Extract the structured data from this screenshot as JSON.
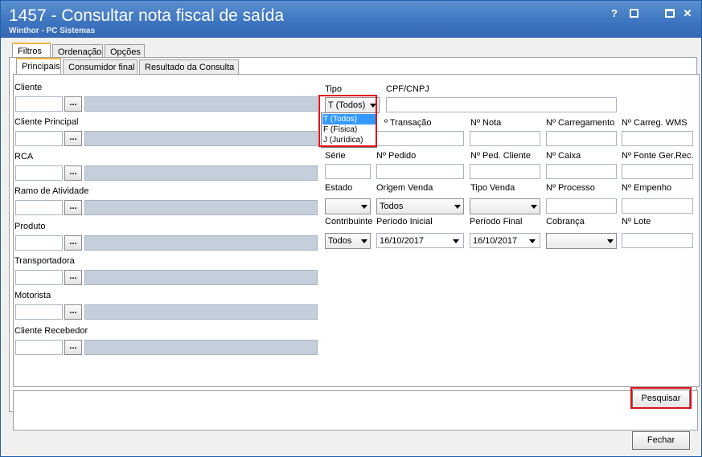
{
  "window": {
    "title": "1457 - Consultar nota fiscal de saída",
    "subtitle": "Winthor - PC Sistemas",
    "help_label": "?"
  },
  "top_tabs": [
    "Filtros",
    "Ordenação",
    "Opções"
  ],
  "sub_tabs": [
    "Principais",
    "Consumidor final",
    "Resultado da Consulta"
  ],
  "left_fields": [
    "Cliente",
    "Cliente Principal",
    "RCA",
    "Ramo de Atividade",
    "Produto",
    "Transportadora",
    "Motorista",
    "Cliente Recebedor"
  ],
  "dots_label": "...",
  "right_labels": {
    "tipo": "Tipo",
    "cpf_cnpj": "CPF/CNPJ",
    "transacao": "º Transação",
    "nota": "Nº Nota",
    "carregamento": "Nº Carregamento",
    "carreg_wms": "Nº Carreg. WMS",
    "serie": "Série",
    "pedido": "Nº Pedido",
    "ped_cliente": "Nº Ped. Cliente",
    "caixa": "Nº Caixa",
    "fonte_ger_rec": "Nº Fonte Ger.Rec.",
    "estado": "Estado",
    "origem_venda": "Origem Venda",
    "tipo_venda": "Tipo Venda",
    "processo": "Nº Processo",
    "empenho": "Nº Empenho",
    "contribuinte": "Contribuinte",
    "periodo_inicial": "Período Inicial",
    "periodo_final": "Período Final",
    "cobranca": "Cobrança",
    "lote": "Nº Lote"
  },
  "values": {
    "tipo": "T (Todos)",
    "origem_venda": "Todos",
    "contribuinte": "Todos",
    "periodo_inicial": "16/10/2017",
    "periodo_final": "16/10/2017"
  },
  "tipo_options": [
    "T (Todos)",
    "F (Física)",
    "J (Jurídica)"
  ],
  "buttons": {
    "pesquisar": "Pesquisar",
    "fechar": "Fechar"
  },
  "colors": {
    "highlight_border": "#e0101a",
    "title_bar": "#3d74bf",
    "selected_option": "#3399ff"
  }
}
